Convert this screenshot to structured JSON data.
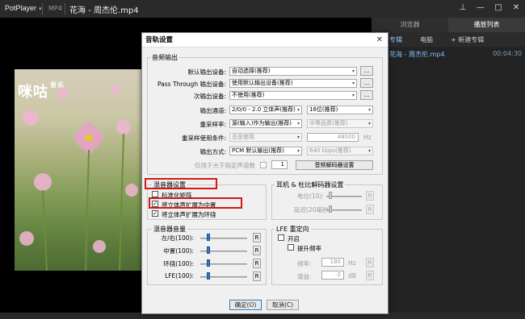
{
  "player": {
    "brand": "PotPlayer",
    "format": "MP4",
    "title": "花海 - 周杰伦.mp4",
    "logo": "咪咕",
    "logo_sub": "音乐"
  },
  "playlist": {
    "tabs": [
      "浏览器",
      "播放列表"
    ],
    "subtabs": [
      "专辑",
      "电脑",
      "+ 新建专辑"
    ],
    "item": {
      "name": "花海 - 周杰伦.mp4",
      "duration": "00:04:30"
    }
  },
  "dialog": {
    "title": "音轨设置",
    "output_group": "音频输出",
    "default_device_label": "默认输出设备:",
    "default_device_value": "自动选择(推荐)",
    "passthrough_label": "Pass Through 输出设备:",
    "passthrough_value": "使用默认输出设备(推荐)",
    "secondary_label": "次输出设备:",
    "secondary_value": "不使用(推荐)",
    "browse": "...",
    "channels_label": "输出通道:",
    "channels_value": "2/0/0 - 2.0 立体声(推荐)",
    "bits_value": "16位(推荐)",
    "resample_label": "重采样率:",
    "resample_value": "源(输入)作为输出(推荐)",
    "quality_value": "中等品质(推荐)",
    "resample_cond_label": "重采样使用条件:",
    "resample_cond_value": "总是使用",
    "hz_value": "48000",
    "hz_unit": "Hz",
    "output_mode_label": "输出方式:",
    "output_mode_value": "PCM 默认输出(推荐)",
    "bitrate_value": "640 kbps(推荐)",
    "only_above_label": "仅用于大于指定声道数",
    "only_above_value": "1",
    "decoder_button": "音频解码器设置",
    "mixer_group": "混音器设置",
    "normalize_label": "标准化矩阵",
    "stereo_center_label": "将立体声扩展为中置",
    "stereo_surround_label": "将立体声扩展为环绕",
    "headphone_group": "耳机 & 杜比解码器设置",
    "level_label": "电位(10):",
    "delay_label": "延迟(20毫秒):",
    "reset": "R",
    "volume_group": "混音器音量",
    "lr_label": "左/右(100):",
    "center_label": "中置(100):",
    "surround_label": "环绕(100):",
    "lfe_label": "LFE(100):",
    "lfe_group": "LFE 重定向",
    "enable_label": "开启",
    "boost_label": "提升频率",
    "freq_label": "频率:",
    "freq_value": "180",
    "freq_unit": "Hz",
    "gain_label": "增益:",
    "gain_value": "-2",
    "gain_unit": "dB",
    "ok": "确定(O)",
    "cancel": "取消(C)"
  }
}
